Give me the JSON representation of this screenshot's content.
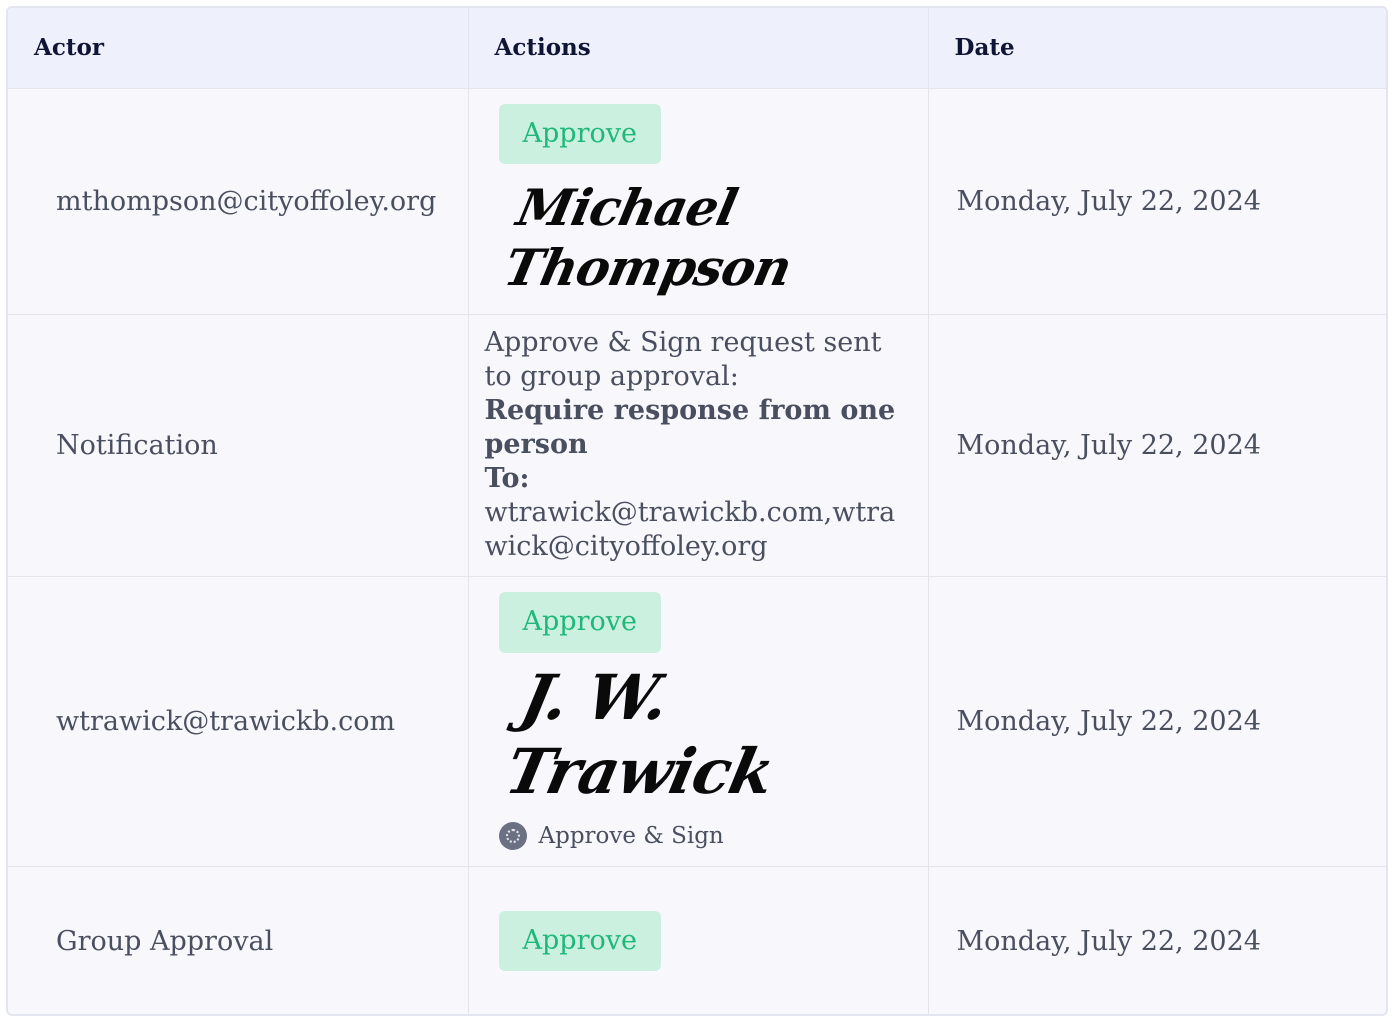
{
  "table": {
    "headers": {
      "actor": "Actor",
      "actions": "Actions",
      "date": "Date"
    },
    "rows": [
      {
        "actor": "mthompson@cityoffoley.org",
        "action_label": "Approve",
        "signature": "Michael Thompson",
        "date": "Monday, July 22, 2024"
      },
      {
        "actor": "Notification",
        "message_line1": "Approve & Sign request sent to group approval:",
        "message_bold": "Require response from one person",
        "to_label": "To:",
        "recipients": "wtrawick@trawickb.com,wtrawick@cityoffoley.org",
        "date": "Monday, July 22, 2024"
      },
      {
        "actor": "wtrawick@trawickb.com",
        "action_label": "Approve",
        "signature": "J. W. Trawick",
        "sub_tag": "Approve & Sign",
        "date": "Monday, July 22, 2024"
      },
      {
        "actor": "Group Approval",
        "action_label": "Approve",
        "date": "Monday, July 22, 2024"
      }
    ]
  },
  "colors": {
    "approve_bg": "#cbf0e0",
    "approve_text": "#1fb878",
    "header_bg": "#eef0fb"
  }
}
